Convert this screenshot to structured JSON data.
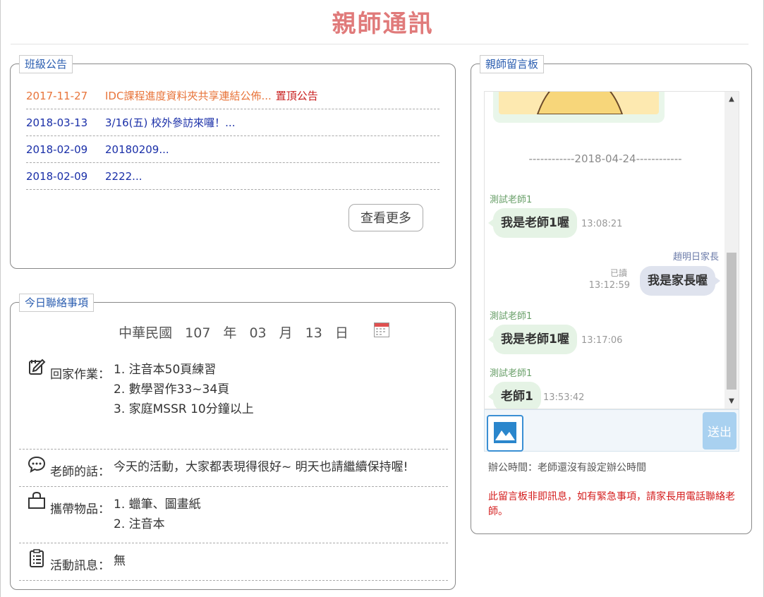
{
  "page_title": "親師通訊",
  "announcements": {
    "legend": "班級公告",
    "items": [
      {
        "date": "2017-11-27",
        "title": "IDC課程進度資料夾共享連結公佈...",
        "tag": "置頂公告"
      },
      {
        "date": "2018-03-13",
        "title": "3/16(五) 校外參訪來囉！...",
        "tag": ""
      },
      {
        "date": "2018-02-09",
        "title": "20180209...",
        "tag": ""
      },
      {
        "date": "2018-02-09",
        "title": "2222...",
        "tag": ""
      }
    ],
    "more_label": "查看更多",
    "colors": {
      "pinned": "#e8743a",
      "pin_tag": "#c81e1e",
      "normal": "#1a2fa8"
    }
  },
  "today": {
    "legend": "今日聯絡事項",
    "date": {
      "era": "中華民國",
      "year": "107",
      "year_unit": "年",
      "month": "03",
      "month_unit": "月",
      "day": "13",
      "day_unit": "日"
    },
    "homework": {
      "label": "回家作業：",
      "items": [
        "1. 注音本50頁練習",
        "2. 數學習作33~34頁",
        "3. 家庭MSSR 10分鐘以上"
      ]
    },
    "teacher_words": {
      "label": "老師的話：",
      "text": "今天的活動，大家都表現得很好~ 明天也請繼續保持喔!"
    },
    "carry_items": {
      "label": "攜帶物品：",
      "items": [
        "1. 蠟筆、圖畫紙",
        "2. 注音本"
      ]
    },
    "activity": {
      "label": "活動訊息：",
      "text": "無"
    }
  },
  "chat": {
    "legend": "親師留言板",
    "date_separator": "------------2018-04-24------------",
    "messages": [
      {
        "sender": "測試老師1",
        "role": "teacher",
        "text": "我是老師1喔",
        "time": "13:08:21"
      },
      {
        "sender": "趙明日家長",
        "role": "parent",
        "text": "我是家長喔",
        "time": "13:12:59",
        "read": "已讀"
      },
      {
        "sender": "測試老師1",
        "role": "teacher",
        "text": "我是老師1喔",
        "time": "13:17:06"
      },
      {
        "sender": "測試老師1",
        "role": "teacher",
        "text": "老師1",
        "time": "13:53:42"
      }
    ],
    "send_label": "送出",
    "office_hours": "辦公時間：老師還沒有設定辦公時間",
    "warning": "此留言板非即訊息，如有緊急事項，請家長用電話聯絡老師。",
    "colors": {
      "teacher_bubble": "#e5f3e5",
      "parent_bubble": "#dfe3ee",
      "warning": "#d41d1d"
    }
  }
}
